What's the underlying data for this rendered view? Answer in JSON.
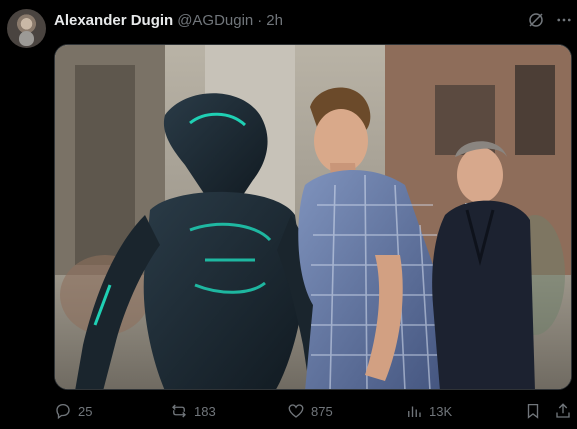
{
  "tweet": {
    "author": {
      "name": "Alexander Dugin",
      "handle": "@AGDugin",
      "separator": "·",
      "time": "2h"
    },
    "media": {
      "kind": "meme-photo",
      "palette": {
        "street": "#8b8579",
        "alien_armor": "#1d2a33",
        "alien_glow": "#1fd0b4",
        "shirt": "#5a6f9e",
        "suit": "#1c2230"
      }
    },
    "actions": {
      "replies": "25",
      "reposts": "183",
      "likes": "875",
      "views": "13K"
    },
    "icons": {
      "grok": "grok-icon",
      "more": "more-icon",
      "reply": "reply-icon",
      "repost": "repost-icon",
      "like": "heart-icon",
      "views": "views-icon",
      "bookmark": "bookmark-icon",
      "share": "share-icon"
    },
    "colors": {
      "background": "#000000",
      "text_primary": "#e7e9ea",
      "text_secondary": "#71767b"
    }
  }
}
